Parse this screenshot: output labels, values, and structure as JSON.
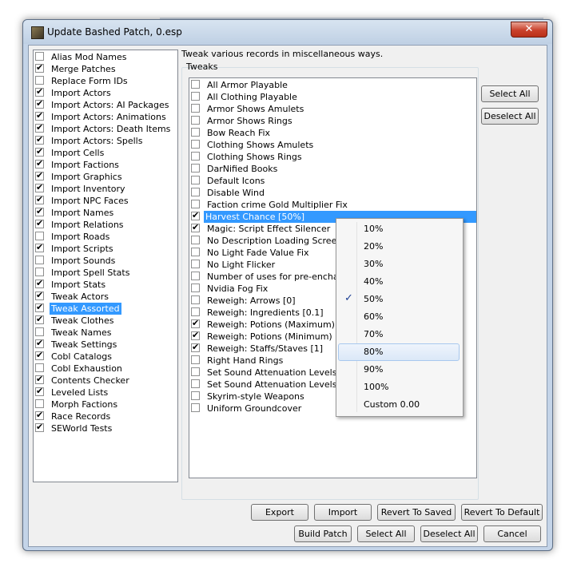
{
  "window": {
    "title": "Update Bashed Patch, 0.esp",
    "close_label": "✕"
  },
  "left_items": [
    {
      "label": "Alias Mod Names",
      "checked": false
    },
    {
      "label": "Merge Patches",
      "checked": true
    },
    {
      "label": "Replace Form IDs",
      "checked": false
    },
    {
      "label": "Import Actors",
      "checked": true
    },
    {
      "label": "Import Actors: AI Packages",
      "checked": true
    },
    {
      "label": "Import Actors: Animations",
      "checked": true
    },
    {
      "label": "Import Actors: Death Items",
      "checked": true
    },
    {
      "label": "Import Actors: Spells",
      "checked": true
    },
    {
      "label": "Import Cells",
      "checked": true
    },
    {
      "label": "Import Factions",
      "checked": true
    },
    {
      "label": "Import Graphics",
      "checked": true
    },
    {
      "label": "Import Inventory",
      "checked": true
    },
    {
      "label": "Import NPC Faces",
      "checked": true
    },
    {
      "label": "Import Names",
      "checked": true
    },
    {
      "label": "Import Relations",
      "checked": true
    },
    {
      "label": "Import Roads",
      "checked": false
    },
    {
      "label": "Import Scripts",
      "checked": true
    },
    {
      "label": "Import Sounds",
      "checked": false
    },
    {
      "label": "Import Spell Stats",
      "checked": false
    },
    {
      "label": "Import Stats",
      "checked": true
    },
    {
      "label": "Tweak Actors",
      "checked": true
    },
    {
      "label": "Tweak Assorted",
      "checked": true,
      "selected": true
    },
    {
      "label": "Tweak Clothes",
      "checked": true
    },
    {
      "label": "Tweak Names",
      "checked": false
    },
    {
      "label": "Tweak Settings",
      "checked": true
    },
    {
      "label": "Cobl Catalogs",
      "checked": true
    },
    {
      "label": "Cobl Exhaustion",
      "checked": false
    },
    {
      "label": "Contents Checker",
      "checked": true
    },
    {
      "label": "Leveled Lists",
      "checked": true
    },
    {
      "label": "Morph Factions",
      "checked": false
    },
    {
      "label": "Race Records",
      "checked": true
    },
    {
      "label": "SEWorld Tests",
      "checked": true
    }
  ],
  "description": "Tweak various records in miscellaneous ways.",
  "tweaks_label": "Tweaks",
  "tweak_items": [
    {
      "label": "All Armor Playable",
      "checked": false
    },
    {
      "label": "All Clothing Playable",
      "checked": false
    },
    {
      "label": "Armor Shows Amulets",
      "checked": false
    },
    {
      "label": "Armor Shows Rings",
      "checked": false
    },
    {
      "label": "Bow Reach Fix",
      "checked": false
    },
    {
      "label": "Clothing Shows Amulets",
      "checked": false
    },
    {
      "label": "Clothing Shows Rings",
      "checked": false
    },
    {
      "label": "DarNified Books",
      "checked": false
    },
    {
      "label": "Default Icons",
      "checked": false
    },
    {
      "label": "Disable Wind",
      "checked": false
    },
    {
      "label": "Faction crime Gold Multiplier Fix",
      "checked": false
    },
    {
      "label": "Harvest Chance [50%]",
      "checked": true,
      "selected": true
    },
    {
      "label": "Magic: Script Effect Silencer",
      "checked": true
    },
    {
      "label": "No Description Loading Screens",
      "checked": false
    },
    {
      "label": "No Light Fade Value Fix",
      "checked": false
    },
    {
      "label": "No Light Flicker",
      "checked": false
    },
    {
      "label": "Number of uses for pre-enchanted",
      "checked": false
    },
    {
      "label": "Nvidia Fog Fix",
      "checked": false
    },
    {
      "label": "Reweigh: Arrows [0]",
      "checked": false
    },
    {
      "label": "Reweigh: Ingredients [0.1]",
      "checked": false
    },
    {
      "label": "Reweigh: Potions (Maximum) [0.1]",
      "checked": true
    },
    {
      "label": "Reweigh: Potions (Minimum) [1]",
      "checked": true
    },
    {
      "label": "Reweigh: Staffs/Staves [1]",
      "checked": true
    },
    {
      "label": "Right Hand Rings",
      "checked": false
    },
    {
      "label": "Set Sound Attenuation Levels [0%",
      "checked": false
    },
    {
      "label": "Set Sound Attenuation Levels: Nirn",
      "checked": false
    },
    {
      "label": "Skyrim-style Weapons",
      "checked": false
    },
    {
      "label": "Uniform Groundcover",
      "checked": false
    }
  ],
  "side_buttons": {
    "select_all": "Select All",
    "deselect_all": "Deselect All"
  },
  "popup_menu": [
    {
      "label": "10%"
    },
    {
      "label": "20%"
    },
    {
      "label": "30%"
    },
    {
      "label": "40%"
    },
    {
      "label": "50%",
      "checked": true
    },
    {
      "label": "60%"
    },
    {
      "label": "70%"
    },
    {
      "label": "80%",
      "hover": true
    },
    {
      "label": "90%"
    },
    {
      "label": "100%"
    },
    {
      "label": "Custom 0.00"
    }
  ],
  "bottom_buttons": {
    "export": "Export",
    "import": "Import",
    "revert_saved": "Revert To Saved",
    "revert_default": "Revert To Default",
    "build_patch": "Build Patch",
    "select_all": "Select All",
    "deselect_all": "Deselect All",
    "cancel": "Cancel"
  },
  "check_glyph": "✔",
  "menu_check_glyph": "✓"
}
